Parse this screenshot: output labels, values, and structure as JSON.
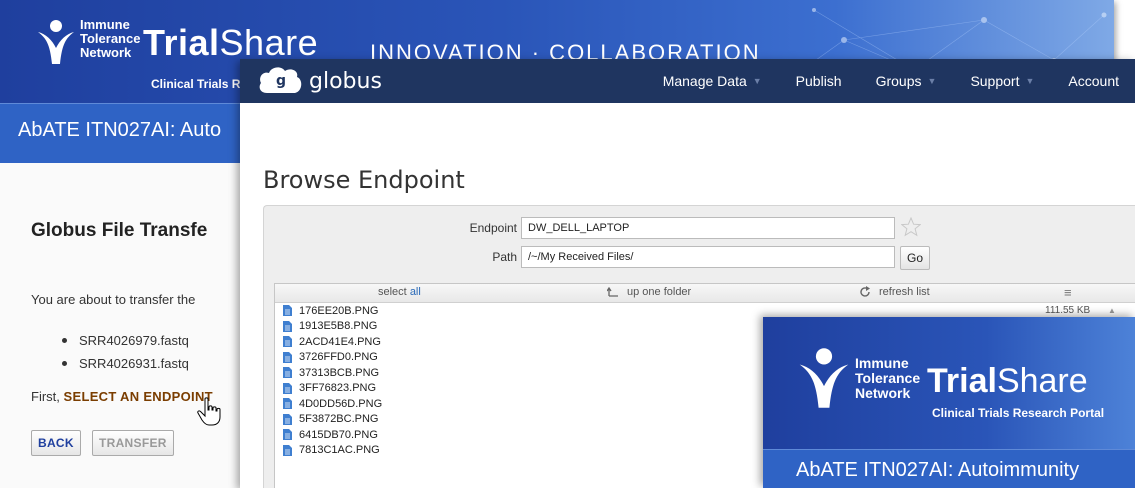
{
  "trialshare_bg": {
    "logo_lines": [
      "Immune",
      "Tolerance",
      "Network"
    ],
    "brand_bold": "Trial",
    "brand_light": "Share",
    "portal_text": "Clinical Trials Re",
    "tagline": "INNOVATION · COLLABORATION",
    "study_title": "AbATE ITN027AI: Auto",
    "heading": "Globus File Transfe",
    "intro": "You are about to transfer the",
    "files": [
      "SRR4026979.fastq",
      "SRR4026931.fastq"
    ],
    "first_prefix": "First,",
    "select_endpoint_link": "SELECT AN ENDPOINT",
    "back_label": "BACK",
    "transfer_label": "TRANSFER"
  },
  "globus": {
    "brand": "globus",
    "nav": [
      {
        "label": "Manage Data",
        "caret": true
      },
      {
        "label": "Publish",
        "caret": false
      },
      {
        "label": "Groups",
        "caret": true
      },
      {
        "label": "Support",
        "caret": true
      },
      {
        "label": "Account",
        "caret": false
      }
    ],
    "page_title": "Browse Endpoint",
    "endpoint_label": "Endpoint",
    "endpoint_value": "DW_DELL_LAPTOP",
    "path_label": "Path",
    "path_value": "/~/My Received Files/",
    "go_label": "Go",
    "select_prefix": "select",
    "select_all": "all",
    "up_folder": "up one folder",
    "refresh": "refresh list",
    "first_size": "111.55 KB",
    "files": [
      "176EE20B.PNG",
      "1913E5B8.PNG",
      "2ACD41E4.PNG",
      "3726FFD0.PNG",
      "37313BCB.PNG",
      "3FF76823.PNG",
      "4D0DD56D.PNG",
      "5F3872BC.PNG",
      "6415DB70.PNG",
      "7813C1AC.PNG"
    ]
  },
  "trialshare_fg": {
    "logo_lines": [
      "Immune",
      "Tolerance",
      "Network"
    ],
    "brand_bold": "Trial",
    "brand_light": "Share",
    "portal_text": "Clinical Trials Research Portal",
    "study_title": "AbATE ITN027AI: Autoimmunity"
  },
  "colors": {
    "trialshare_blue": "#1f3f9e",
    "globus_navy": "#1f3560",
    "endpoint_link": "#7a3d00"
  }
}
